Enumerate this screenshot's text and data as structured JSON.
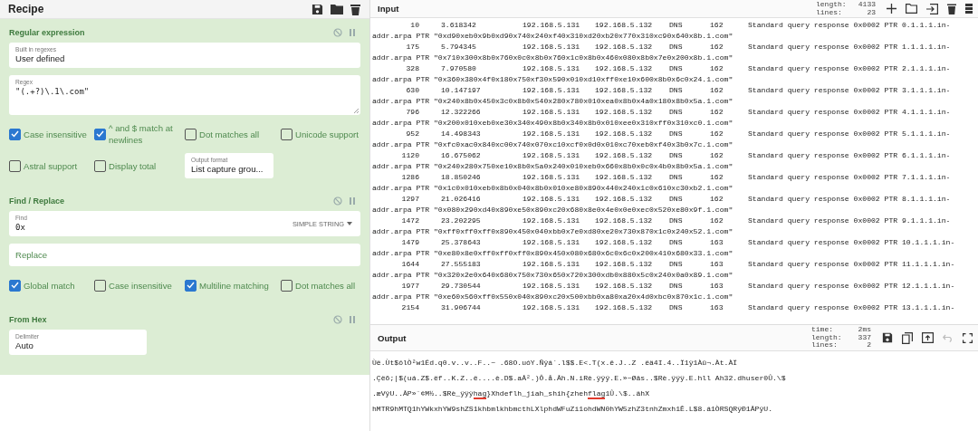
{
  "recipe": {
    "title": "Recipe"
  },
  "operations": [
    {
      "title": "Regular expression",
      "rows": [
        [
          {
            "kind": "field",
            "label": "Built in regexes",
            "value": "User defined"
          }
        ],
        [
          {
            "kind": "textarea",
            "label": "Regex",
            "value": "\"(.+?)\\.1\\.com\""
          }
        ],
        [
          {
            "kind": "checkbox",
            "label": "Case insensitive",
            "checked": true
          },
          {
            "kind": "checkbox",
            "label": "^ and $ match at newlines",
            "checked": true
          },
          {
            "kind": "checkbox",
            "label": "Dot matches all",
            "checked": false
          },
          {
            "kind": "checkbox",
            "label": "Unicode support",
            "checked": false
          }
        ],
        [
          {
            "kind": "checkbox",
            "label": "Astral support",
            "checked": false
          },
          {
            "kind": "checkbox",
            "label": "Display total",
            "checked": false
          },
          {
            "kind": "select",
            "label": "Output format",
            "value": "List capture grou..."
          }
        ]
      ]
    },
    {
      "title": "Find / Replace",
      "rows": [
        [
          {
            "kind": "find",
            "label": "Find",
            "value": "0x",
            "option": "SIMPLE STRING"
          }
        ],
        [
          {
            "kind": "placeholder",
            "placeholder": "Replace"
          }
        ],
        [
          {
            "kind": "checkbox",
            "label": "Global match",
            "checked": true
          },
          {
            "kind": "checkbox",
            "label": "Case insensitive",
            "checked": false
          },
          {
            "kind": "checkbox",
            "label": "Multiline matching",
            "checked": true
          },
          {
            "kind": "checkbox",
            "label": "Dot matches all",
            "checked": false
          }
        ]
      ]
    },
    {
      "title": "From Hex",
      "rows": [
        [
          {
            "kind": "half",
            "label": "Delimiter",
            "value": "Auto"
          }
        ]
      ]
    }
  ],
  "input": {
    "title": "Input",
    "length_label": "length:",
    "length": "4133",
    "lines_label": "lines:",
    "lines": "23",
    "rows": [
      {
        "no": "10",
        "time": "3.618342",
        "src": "192.168.5.131",
        "dst": "192.168.5.132",
        "proto": "DNS",
        "len": "162",
        "info": "Standard query response 0x0002 PTR 0.1.1.1.in-",
        "cont": "addr.arpa PTR \"0xd90xeb0x9b0xd90x740x240xf40x310xd20xb20x770x310xc90x640x8b.1.com\""
      },
      {
        "no": "175",
        "time": "5.794345",
        "src": "192.168.5.131",
        "dst": "192.168.5.132",
        "proto": "DNS",
        "len": "162",
        "info": "Standard query response 0x0002 PTR 1.1.1.1.in-",
        "cont": "addr.arpa PTR \"0x710x300x8b0x760x0c0x8b0x760x1c0x8b0x460x080x8b0x7e0x200x8b.1.com\""
      },
      {
        "no": "328",
        "time": "7.970580",
        "src": "192.168.5.131",
        "dst": "192.168.5.132",
        "proto": "DNS",
        "len": "162",
        "info": "Standard query response 0x0002 PTR 2.1.1.1.in-",
        "cont": "addr.arpa PTR \"0x360x380x4f0x180x750xf30x590x010xd10xff0xe10x600x8b0x6c0x24.1.com\""
      },
      {
        "no": "630",
        "time": "10.147197",
        "src": "192.168.5.131",
        "dst": "192.168.5.132",
        "proto": "DNS",
        "len": "162",
        "info": "Standard query response 0x0002 PTR 3.1.1.1.in-",
        "cont": "addr.arpa PTR \"0x240x8b0x450x3c0x8b0x540x280x780x010xea0x8b0x4a0x180x8b0x5a.1.com\""
      },
      {
        "no": "796",
        "time": "12.322266",
        "src": "192.168.5.131",
        "dst": "192.168.5.132",
        "proto": "DNS",
        "len": "162",
        "info": "Standard query response 0x0002 PTR 4.1.1.1.in-",
        "cont": "addr.arpa PTR \"0x200x010xeb0xe30x340x490x8b0x340x8b0x010xee0x310xff0x310xc0.1.com\""
      },
      {
        "no": "952",
        "time": "14.498343",
        "src": "192.168.5.131",
        "dst": "192.168.5.132",
        "proto": "DNS",
        "len": "162",
        "info": "Standard query response 0x0002 PTR 5.1.1.1.in-",
        "cont": "addr.arpa PTR \"0xfc0xac0x840xc00x740x070xc10xcf0x0d0x010xc70xeb0xf40x3b0x7c.1.com\""
      },
      {
        "no": "1120",
        "time": "16.675062",
        "src": "192.168.5.131",
        "dst": "192.168.5.132",
        "proto": "DNS",
        "len": "162",
        "info": "Standard query response 0x0002 PTR 6.1.1.1.in-",
        "cont": "addr.arpa PTR \"0x240x280x750xe10x8b0x5a0x240x010xeb0x660x8b0x0c0x4b0x8b0x5a.1.com\""
      },
      {
        "no": "1286",
        "time": "18.850246",
        "src": "192.168.5.131",
        "dst": "192.168.5.132",
        "proto": "DNS",
        "len": "162",
        "info": "Standard query response 0x0002 PTR 7.1.1.1.in-",
        "cont": "addr.arpa PTR \"0x1c0x010xeb0x8b0x040x8b0x010xe80x890x440x240x1c0x610xc30xb2.1.com\""
      },
      {
        "no": "1297",
        "time": "21.026416",
        "src": "192.168.5.131",
        "dst": "192.168.5.132",
        "proto": "DNS",
        "len": "162",
        "info": "Standard query response 0x0002 PTR 8.1.1.1.in-",
        "cont": "addr.arpa PTR \"0x080x290xd40x890xe50x890xc20x680x8e0x4e0x0e0xec0x520xe80x9f.1.com\""
      },
      {
        "no": "1472",
        "time": "23.202295",
        "src": "192.168.5.131",
        "dst": "192.168.5.132",
        "proto": "DNS",
        "len": "162",
        "info": "Standard query response 0x0002 PTR 9.1.1.1.in-",
        "cont": "addr.arpa PTR \"0xff0xff0xff0x890x450x040xbb0x7e0xd80xe20x730x870x1c0x240x52.1.com\""
      },
      {
        "no": "1479",
        "time": "25.378643",
        "src": "192.168.5.131",
        "dst": "192.168.5.132",
        "proto": "DNS",
        "len": "163",
        "info": "Standard query response 0x0002 PTR 10.1.1.1.in-",
        "cont": "addr.arpa PTR \"0xe80x8e0xff0xff0xff0x890x450x080x680x6c0x6c0x200x410x680x33.1.com\""
      },
      {
        "no": "1644",
        "time": "27.555183",
        "src": "192.168.5.131",
        "dst": "192.168.5.132",
        "proto": "DNS",
        "len": "163",
        "info": "Standard query response 0x0002 PTR 11.1.1.1.in-",
        "cont": "addr.arpa PTR \"0x320x2e0x640x680x750x730x650x720x300xdb0x880x5c0x240x0a0x89.1.com\""
      },
      {
        "no": "1977",
        "time": "29.730544",
        "src": "192.168.5.131",
        "dst": "192.168.5.132",
        "proto": "DNS",
        "len": "163",
        "info": "Standard query response 0x0002 PTR 12.1.1.1.in-",
        "cont": "addr.arpa PTR \"0xe60x560xff0x550x040x890xc20x500xbb0xa80xa20x4d0xbc0x870x1c.1.com\""
      },
      {
        "no": "2154",
        "time": "31.906744",
        "src": "192.168.5.131",
        "dst": "192.168.5.132",
        "proto": "DNS",
        "len": "163",
        "info": "Standard query response 0x0002 PTR 13.1.1.1.in-"
      }
    ]
  },
  "output": {
    "title": "Output",
    "time_label": "time:",
    "time": "2ms",
    "length_label": "length:",
    "length": "337",
    "lines_label": "lines:",
    "lines": "2",
    "lines_text": [
      [
        {
          "text": "Ùë.Ùt$ôlÒ²w1Éd.q0.v..v..F..~ .68O.uóY.Ñÿá`.l$$.E<.T(x.ê.J..Z .ëä4I.4..Ï1ÿ1Àû¬.Àt.ÀÏ",
          "marked": false
        }
      ],
      [
        {
          "text": ".Çëõ;|$(uá.Z$.ëf..K.Z..ë....è.D$.aÅ².)Ô.å.Åh.N.iRè.ÿÿÿ.E.»~Øâs..$Rè.ÿÿÿ.E.hll Ah32.dhuser0Û.\\$",
          "marked": false
        }
      ],
      [
        {
          "text": ".æVÿU..ÅP»¨¢M½..$Rè_ÿÿÿ",
          "marked": false
        },
        {
          "text": "hag",
          "marked": true
        },
        {
          "text": "}Xhdeflh_jiah_shih{zheh",
          "marked": false
        },
        {
          "text": "flag",
          "marked": true
        },
        {
          "text": "1Û.\\$..ähX",
          "marked": false
        }
      ],
      [
        {
          "text": "hMTR9hMTQ1hYWkxhYW9shZS1khbmlkhbmcthLXlphdWFuZi1ohdWN0hYW5zhZ3tnhZmxh1Ê.L$8.á1ÒRSQRÿÐ1ÅPÿU.",
          "marked": false
        }
      ]
    ]
  }
}
